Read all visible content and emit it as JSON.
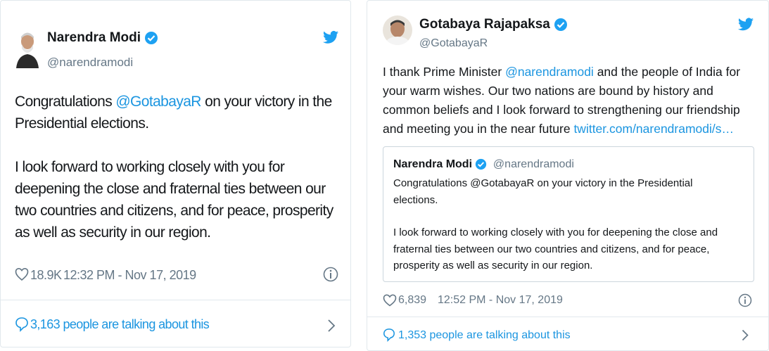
{
  "tweet_left": {
    "author_name": "Narendra Modi",
    "author_handle": "@narendramodi",
    "text_p1_before": "Congratulations ",
    "text_p1_mention": "@GotabayaR",
    "text_p1_after": " on your victory in the Presidential elections.",
    "text_p2": "I look forward to working closely with you for deepening the close and fraternal ties between our two countries and citizens, and for peace, prosperity as well as security in our region.",
    "likes": "18.9K",
    "timestamp": "12:32 PM - Nov 17, 2019",
    "talking": "3,163 people are talking about this"
  },
  "tweet_right": {
    "author_name": "Gotabaya Rajapaksa",
    "author_handle": "@GotabayaR",
    "text_before": "I thank Prime Minister ",
    "text_mention": "@narendramodi",
    "text_after": " and the people of India for your warm wishes. Our two nations are bound by history and common beliefs and I look forward to strengthening our friendship and meeting you in the near future ",
    "text_link": "twitter.com/narendramodi/s…",
    "quoted": {
      "author_name": "Narendra Modi",
      "author_handle": "@narendramodi",
      "text_p1": "Congratulations @GotabayaR on your victory in the Presidential elections.",
      "text_p2": "I look forward to working closely with you for deepening the close and fraternal ties between our two countries and citizens, and for peace, prosperity as well as security in our region."
    },
    "likes": "6,839",
    "timestamp": "12:52 PM - Nov 17, 2019",
    "talking": "1,353 people are talking about this"
  },
  "colors": {
    "link": "#1b95e0",
    "muted": "#657786",
    "border": "#e1e8ed",
    "verified": "#1da1f2"
  }
}
